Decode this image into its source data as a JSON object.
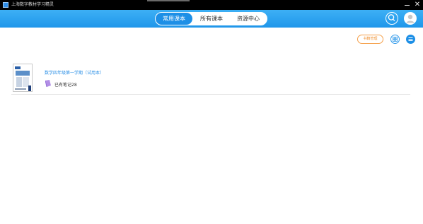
{
  "window": {
    "title": "上海数字教材学习精灵",
    "icon": "app-book-icon"
  },
  "header": {
    "tabs": [
      {
        "label": "常用课本",
        "active": true
      },
      {
        "label": "所有课本",
        "active": false
      },
      {
        "label": "资源中心",
        "active": false
      }
    ],
    "search_icon": "search-icon",
    "avatar_icon": "user-avatar-icon",
    "accent_color": "#1d8fe6"
  },
  "toolbar": {
    "manage_label": "书籍管理",
    "manage_color": "#f09030",
    "grid_view_icon": "grid-view-icon",
    "list_view_icon": "list-view-icon"
  },
  "books": [
    {
      "title": "数学四年级第一学期（试用本）",
      "cover_icon": "book-cover-thumbnail",
      "notes_icon": "notebook-icon",
      "notes_text": "已有笔记28"
    }
  ]
}
